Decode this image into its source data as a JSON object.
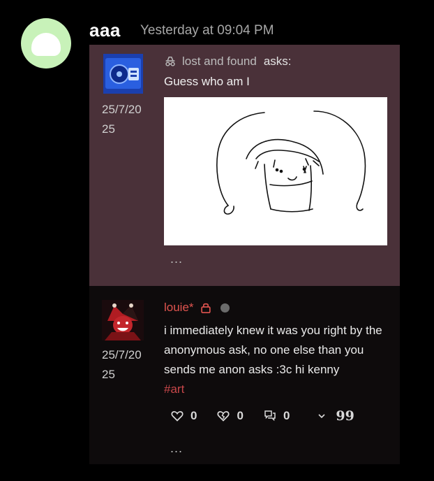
{
  "post": {
    "author": "aaa",
    "timestamp": "Yesterday at 09:04 PM"
  },
  "ask": {
    "date": "25/7/20 25",
    "asker": "lost and found",
    "asks_label": "asks:",
    "question": "Guess who am I",
    "more": "..."
  },
  "reply": {
    "date": "25/7/20 25",
    "username": "louie*",
    "body": "i immediately knew it was you right by the anonymous ask, no one else than you sends me anon asks :3c hi kenny",
    "tag": "#art",
    "like_count": "0",
    "heartbreak_count": "0",
    "comment_count": "0",
    "more": "..."
  },
  "colors": {
    "ask_bg": "#4a3139",
    "reply_bg": "#0e0b0c",
    "username": "#e0544f",
    "tag": "#c8474a",
    "avatar_bg": "#c8f2b9"
  },
  "icons": [
    "incognito-icon",
    "lock-icon",
    "heart-icon",
    "broken-heart-icon",
    "comment-icon",
    "chevron-down-icon",
    "quote-icon"
  ]
}
